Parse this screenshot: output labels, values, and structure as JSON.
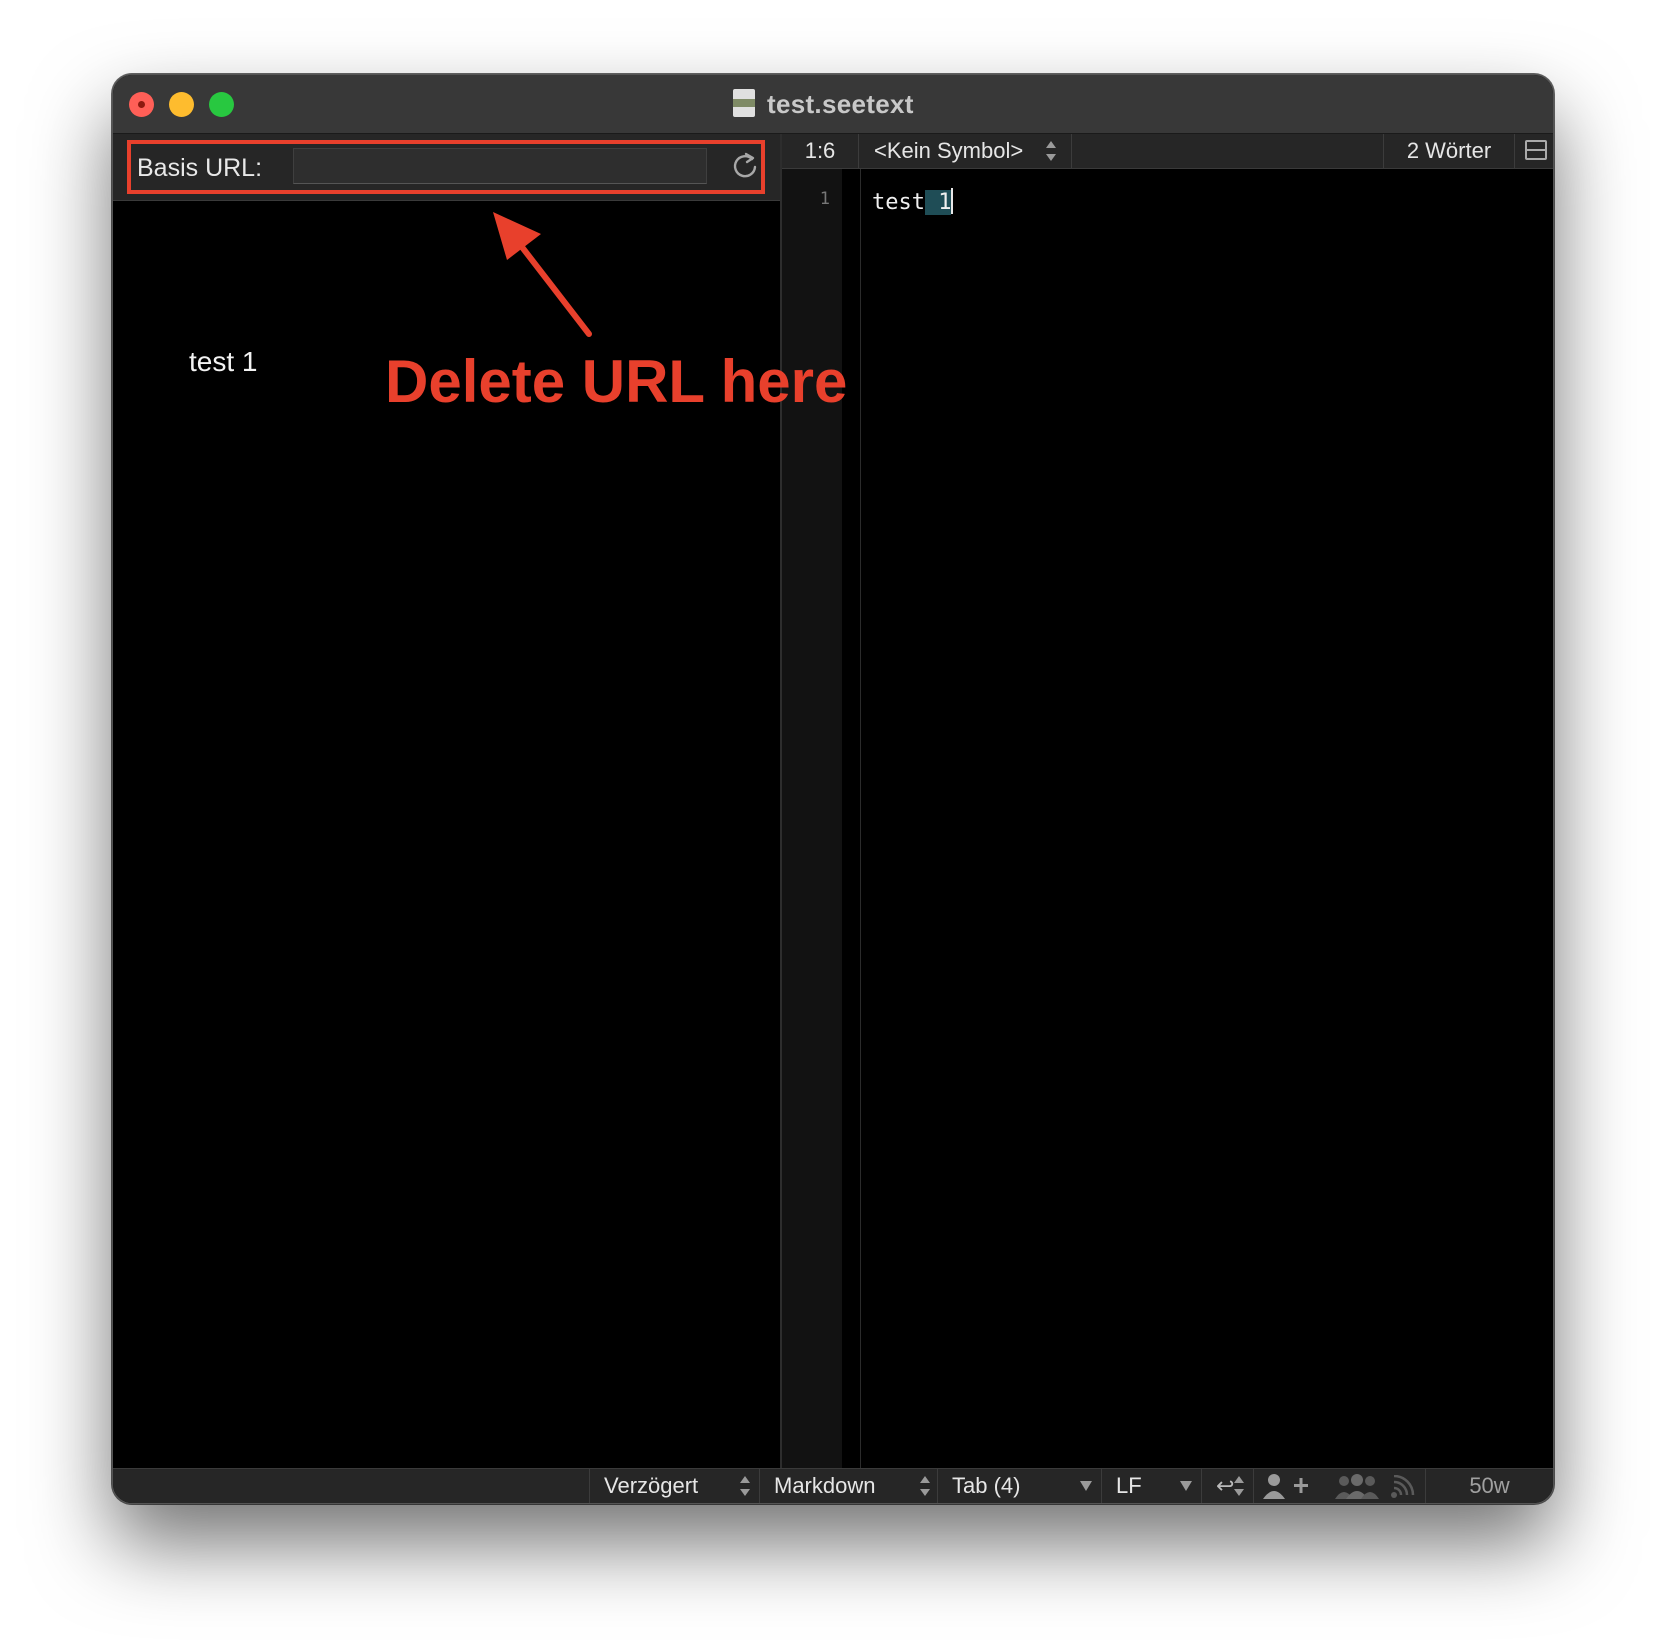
{
  "window": {
    "title": "test.seetext"
  },
  "preview": {
    "base_url_label": "Basis URL:",
    "base_url_value": "",
    "rendered_text": "test 1"
  },
  "annotation": {
    "text": "Delete URL here",
    "color": "#e8402c"
  },
  "editor": {
    "cursor_position": "1:6",
    "symbol_popup": "<Kein Symbol>",
    "word_count": "2 Wörter",
    "line_number": "1",
    "line_text_plain": "test",
    "line_text_selected": " 1"
  },
  "status_bar": {
    "preview_mode": "Verzögert",
    "language": "Markdown",
    "tab_setting": "Tab (4)",
    "line_endings": "LF",
    "wrap_indicator": "↩",
    "window_width": "50w"
  },
  "colors": {
    "traffic_close": "#ff5f57",
    "traffic_min": "#febc2e",
    "traffic_max": "#28c840",
    "selection": "#1f4d56"
  }
}
